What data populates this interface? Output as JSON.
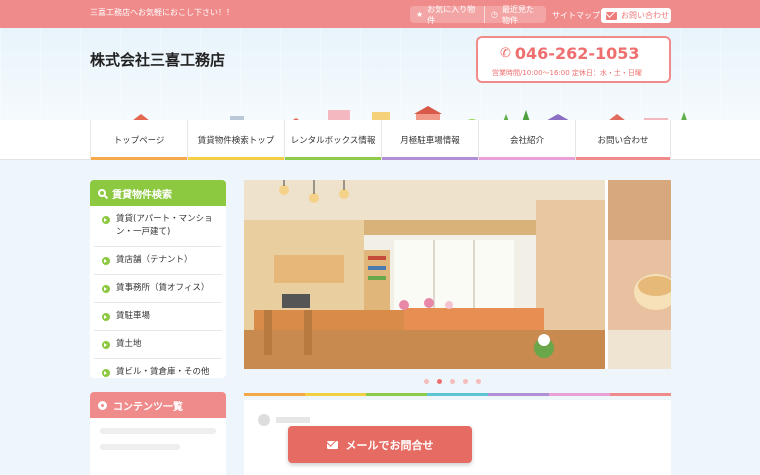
{
  "topbar": {
    "greeting": "三喜工務店へお気軽におこし下さい！！",
    "favorites_label": "お気に入り物件",
    "recent_label": "最近見た物件",
    "sitemap_label": "サイトマップ",
    "contact_label": "お問い合わせ"
  },
  "header": {
    "company_name": "株式会社三喜工務店",
    "phone": "046-262-1053",
    "hours": "営業時間/10:00〜16:00 定休日：水・土・日曜"
  },
  "nav": {
    "items": [
      {
        "label": "トップページ",
        "color": "#f5a94a"
      },
      {
        "label": "賃貸物件検索トップ",
        "color": "#f3cf45"
      },
      {
        "label": "レンタルボックス情報",
        "color": "#8fcb4a"
      },
      {
        "label": "月極駐車場情報",
        "color": "#b08fd6"
      },
      {
        "label": "会社紹介",
        "color": "#e8a0d6"
      },
      {
        "label": "お問い合わせ",
        "color": "#f08b8b"
      }
    ]
  },
  "sidebar": {
    "title": "賃貸物件検索",
    "items": [
      {
        "label": "賃貸(アパート・マンション・一戸建て)"
      },
      {
        "label": "賃店舗（テナント）"
      },
      {
        "label": "賃事務所（賃オフィス）"
      },
      {
        "label": "賃駐車場"
      },
      {
        "label": "賃土地"
      },
      {
        "label": "賃ビル・賃倉庫・その他"
      }
    ]
  },
  "contents": {
    "title": "コンテンツ一覧"
  },
  "slider": {
    "dot_count": 5,
    "active_index": 1
  },
  "cta": {
    "mail_label": "メールでお問合せ"
  },
  "colors": {
    "accent": "#f08b8b",
    "green": "#8cc840"
  }
}
